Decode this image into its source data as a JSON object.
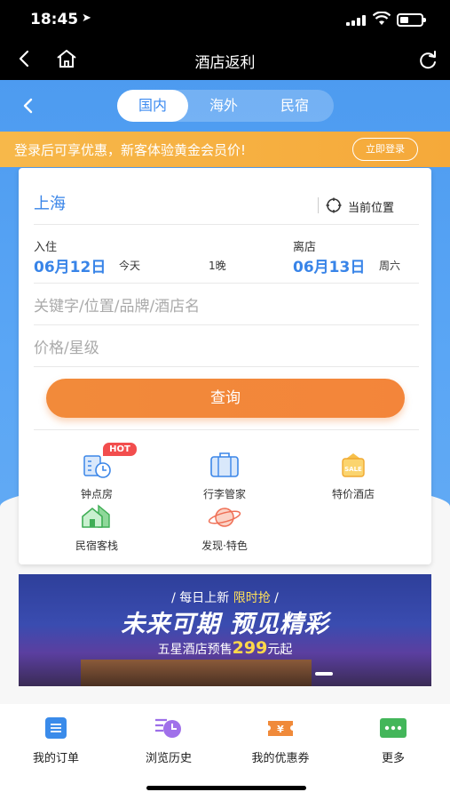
{
  "status_bar": {
    "time": "18:45",
    "location_arrow": "➤"
  },
  "nav": {
    "title": "酒店返利"
  },
  "tabs": [
    {
      "label": "国内",
      "active": true
    },
    {
      "label": "海外",
      "active": false
    },
    {
      "label": "民宿",
      "active": false
    }
  ],
  "promo": {
    "text": "登录后可享优惠，新客体验黄金会员价!",
    "button": "立即登录"
  },
  "search": {
    "city": "上海",
    "current_location": "当前位置",
    "checkin_label": "入住",
    "checkin_date": "06月12日",
    "checkin_day": "今天",
    "nights": "1晚",
    "checkout_label": "离店",
    "checkout_date": "06月13日",
    "checkout_day": "周六",
    "keyword_placeholder": "关键字/位置/品牌/酒店名",
    "price_placeholder": "价格/星级",
    "search_button": "查询"
  },
  "services": [
    {
      "label": "钟点房",
      "icon": "hourly-room-icon",
      "badge": "HOT"
    },
    {
      "label": "行李管家",
      "icon": "luggage-icon"
    },
    {
      "label": "特价酒店",
      "icon": "sale-tag-icon",
      "icon_text": "SALE"
    },
    {
      "label": "民宿客栈",
      "icon": "house-icon"
    },
    {
      "label": "发现·特色",
      "icon": "planet-icon"
    }
  ],
  "banner": {
    "line1_prefix": "/ 每日上新 ",
    "line1_highlight": "限时抢",
    "line1_suffix": " /",
    "line2": "未来可期 预见精彩",
    "line3_prefix": "五星酒店预售",
    "line3_price": "299",
    "line3_suffix": "元起"
  },
  "bottom_tabs": [
    {
      "label": "我的订单",
      "icon": "order-list-icon"
    },
    {
      "label": "浏览历史",
      "icon": "history-icon"
    },
    {
      "label": "我的优惠券",
      "icon": "coupon-icon",
      "icon_text": "¥"
    },
    {
      "label": "更多",
      "icon": "more-icon"
    }
  ],
  "colors": {
    "primary_blue": "#3884e8",
    "orange": "#f28a3a",
    "promo_yellow": "#f7b84a",
    "header_blue": "#5aa6f5"
  }
}
